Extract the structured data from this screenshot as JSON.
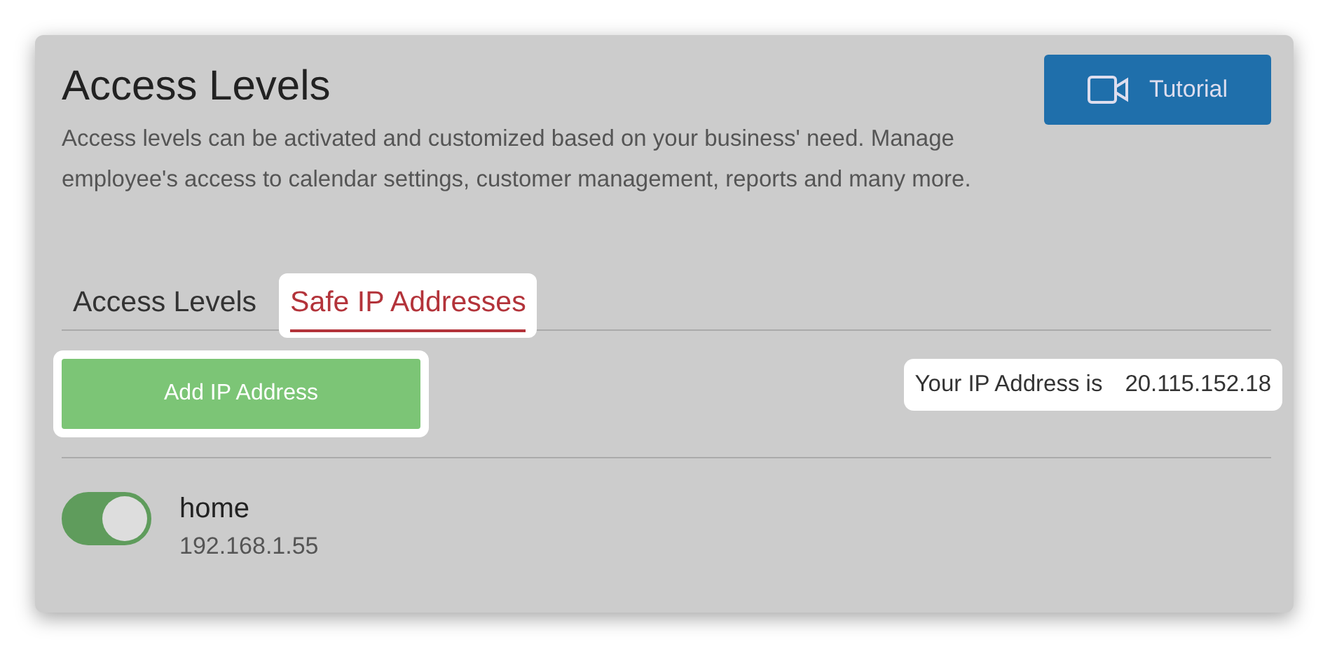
{
  "header": {
    "title": "Access Levels",
    "description": "Access levels can be activated and customized based on your business' need. Manage employee's access to calendar settings, customer management, reports and many more.",
    "tutorial_button": {
      "label": "Tutorial"
    }
  },
  "tabs": [
    {
      "label": "Access Levels",
      "selected": false,
      "highlighted": false
    },
    {
      "label": "Safe IP Addresses",
      "selected": true,
      "highlighted": true
    }
  ],
  "add_button": {
    "label": "Add IP Address",
    "highlighted": true
  },
  "ip_info": {
    "label": "Your IP Address is",
    "value": "20.115.152.18",
    "highlighted": true
  },
  "safe_ips": [
    {
      "name": "home",
      "address": "192.168.1.55",
      "on": true
    }
  ]
}
